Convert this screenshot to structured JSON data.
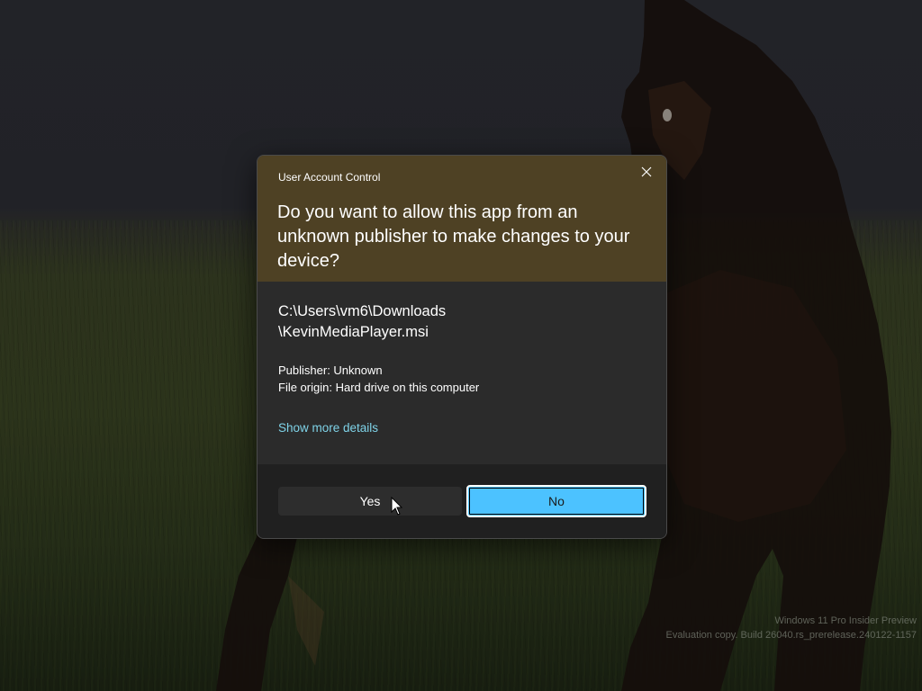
{
  "dialog": {
    "title": "User Account Control",
    "question": "Do you want to allow this app from an unknown publisher to make changes to your device?",
    "file_path_line1": "C:\\Users\\vm6\\Downloads",
    "file_path_line2": "\\KevinMediaPlayer.msi",
    "publisher": "Publisher: Unknown",
    "file_origin": "File origin: Hard drive on this computer",
    "more_details_link": "Show more details",
    "yes_label": "Yes",
    "no_label": "No",
    "close_icon": "close-icon"
  },
  "watermark": {
    "line1": "Windows 11 Pro Insider Preview",
    "line2": "Evaluation copy. Build 26040.rs_prerelease.240122-1157"
  },
  "colors": {
    "header_bg": "#4e4124",
    "body_bg": "#2b2b2b",
    "footer_bg": "#202020",
    "accent": "#4cc2ff",
    "link": "#7fd3e8"
  }
}
